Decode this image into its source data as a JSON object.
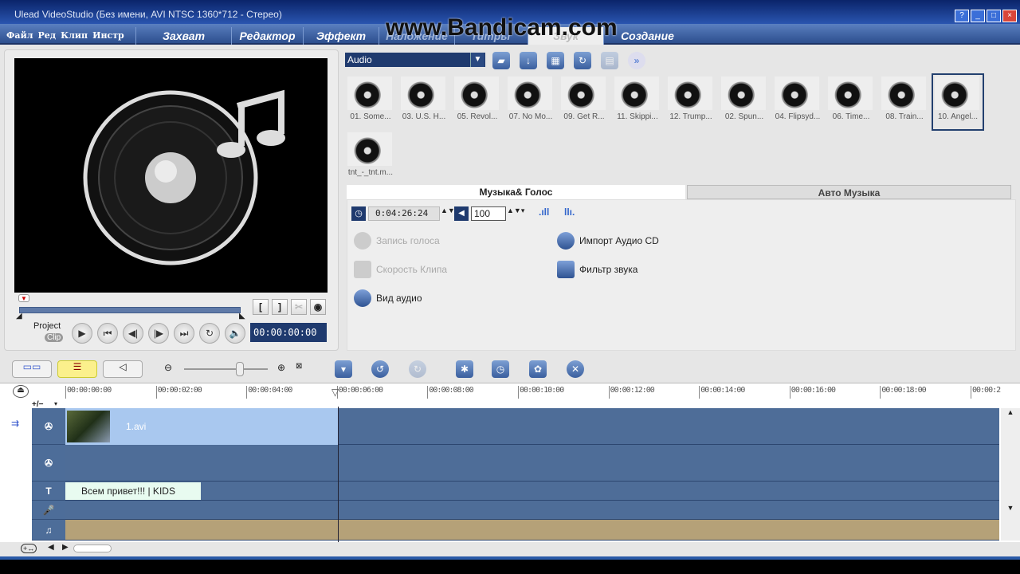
{
  "window": {
    "title": "Ulead VideoStudio (Без имени, AVI NTSC 1360*712 - Стерео)",
    "buttons": [
      "?",
      "_",
      "□",
      "×"
    ]
  },
  "watermark": "www.Bandicam.com",
  "menu": [
    "Файл",
    "Ред",
    "Клип",
    "Инстр"
  ],
  "steps": [
    {
      "label": "Захват"
    },
    {
      "label": "Редактор"
    },
    {
      "label": "Эффект"
    },
    {
      "label": "Наложение"
    },
    {
      "label": "Титры"
    },
    {
      "label": "Звук"
    },
    {
      "label": "Создание"
    }
  ],
  "preview": {
    "mode_project": "Project",
    "mode_clip": "Clip",
    "timecode": "00:00:00:00",
    "mark_in": "[",
    "mark_out": "]"
  },
  "library": {
    "category": "Audio",
    "items": [
      "01. Some...",
      "03. U.S. H...",
      "05. Revol...",
      "07. No Mo...",
      "09. Get R...",
      "11. Skippi...",
      "12. Trump...",
      "02. Spun...",
      "04. Flipsyd...",
      "06. Time...",
      "08. Train...",
      "10. Angel...",
      "tnt_-_tnt.m..."
    ],
    "selected_index": 11
  },
  "options": {
    "tabs": [
      "Музыка& Голос",
      "Авто Музыка"
    ],
    "active_tab": 0,
    "duration": "0:04:26:24",
    "volume": "100",
    "actions": [
      {
        "label": "Запись голоса",
        "enabled": false
      },
      {
        "label": "Импорт Аудио CD",
        "enabled": true
      },
      {
        "label": "Скорость Клипа",
        "enabled": false
      },
      {
        "label": "Фильтр звука",
        "enabled": true
      },
      {
        "label": "Вид аудио",
        "enabled": true
      }
    ]
  },
  "timeline": {
    "ruler": [
      "00:00:00:00",
      "00:00:02:00",
      "00:00:04:00",
      "00:00:06:00",
      "00:00:08:00",
      "00:00:10:00",
      "00:00:12:00",
      "00:00:14:00",
      "00:00:16:00",
      "00:00:18:00",
      "00:00:2"
    ],
    "add_remove": "+/−",
    "video_clip": "1.avi",
    "title_clip": "Всем привет!!! | KIDS",
    "colors": {
      "video_track": "#a9c8ef",
      "overlay_track": "#4e6d98",
      "music_track": "#b5a178",
      "title_clip": "#e8fbf0"
    }
  }
}
